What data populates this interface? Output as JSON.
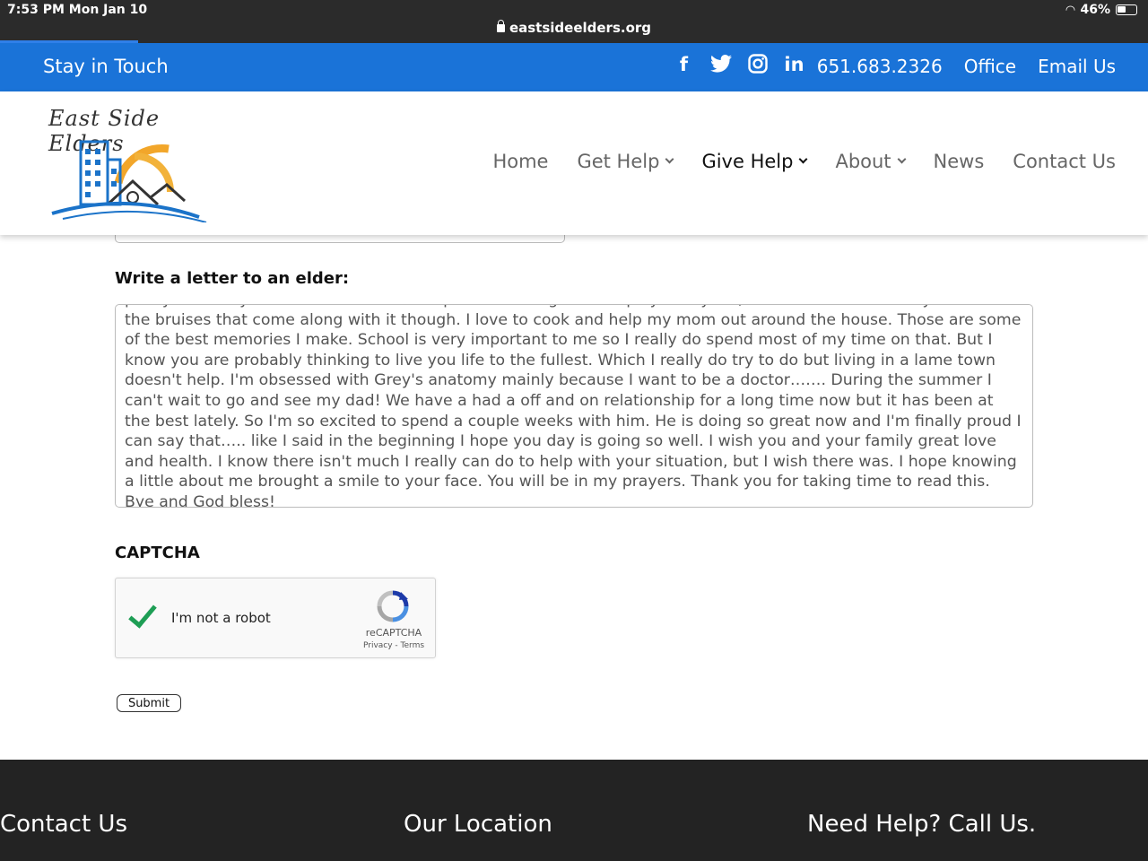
{
  "status_bar": {
    "time_date": "7:53 PM   Mon Jan 10",
    "url": "eastsideelders.org",
    "battery": "46%"
  },
  "top_bar": {
    "stay_in_touch": "Stay in Touch",
    "social": [
      "facebook-icon",
      "twitter-icon",
      "instagram-icon",
      "linkedin-icon"
    ],
    "phone": "651.683.2326",
    "office": "Office",
    "email": "Email Us",
    "color": "#1a73d8"
  },
  "header": {
    "logo_text": "East Side Elders",
    "nav": [
      {
        "label": "Home",
        "has_dropdown": false,
        "active": false
      },
      {
        "label": "Get Help",
        "has_dropdown": true,
        "active": false
      },
      {
        "label": "Give Help",
        "has_dropdown": true,
        "active": true
      },
      {
        "label": "About",
        "has_dropdown": true,
        "active": false
      },
      {
        "label": "News",
        "has_dropdown": false,
        "active": false
      },
      {
        "label": "Contact Us",
        "has_dropdown": false,
        "active": false
      }
    ]
  },
  "form": {
    "letter_label": "Write a letter to an elder:",
    "letter_text": "pretty much my best friend and have helped me through a lot. I play volleyball, which I love. I definitely don't love the bruises that come along with it though. I love to cook and help my mom out around the house. Those are some of the best memories I make. School is very important to me so I really do spend most of my time on that. But I know you are probably thinking to live you life to the fullest. Which I really do try to do but living in a lame town doesn't help. I'm obsessed with Grey's anatomy mainly because I want to be a doctor……. During the summer I can't wait to go and see my dad! We have a had a off and on relationship for a long time now but it has been at the best lately. So I'm so excited to spend a couple weeks with him. He is doing so great now and I'm finally proud I can say that….. like I said in the beginning I hope you day is going so well. I wish you and your family great love and health. I know there isn't much I really can do to help with your situation, but I wish there was. I hope knowing a little about me brought a smile to your face. You will be in my prayers. Thank you for taking time to read this. Bye and God bless!",
    "captcha_label": "CAPTCHA",
    "recaptcha": {
      "checkbox_label": "I'm not a robot",
      "brand": "reCAPTCHA",
      "links": "Privacy - Terms",
      "checked": true
    },
    "submit_label": "Submit"
  },
  "footer": {
    "contact": "Contact Us",
    "location": "Our Location",
    "help": "Need Help?  Call Us."
  }
}
